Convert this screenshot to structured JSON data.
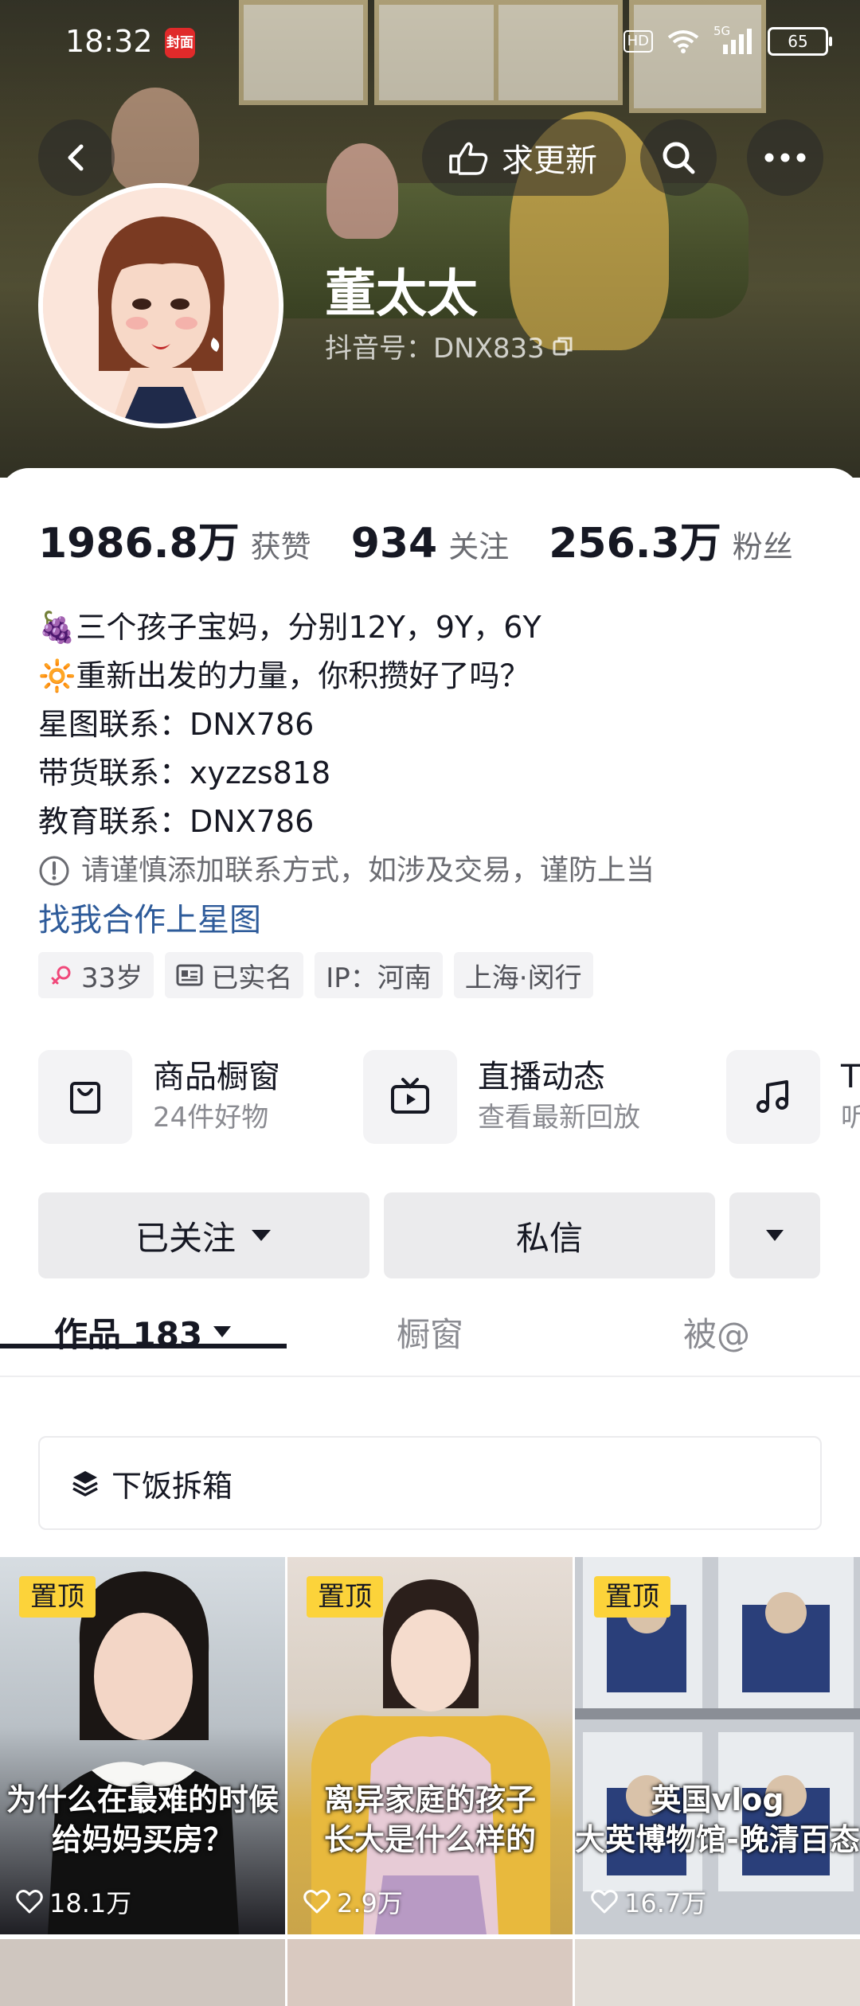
{
  "status_bar": {
    "time": "18:32",
    "news_badge": "封面",
    "hd": "HD",
    "network": "5G",
    "battery": "65"
  },
  "header": {
    "update_label": "求更新",
    "nickname": "董太太",
    "douyin_id": "抖音号：DNX833"
  },
  "stats": [
    {
      "value": "1986.8万",
      "label": "获赞"
    },
    {
      "value": "934",
      "label": "关注"
    },
    {
      "value": "256.3万",
      "label": "粉丝"
    }
  ],
  "bio": {
    "lines": [
      "🍇三个孩子宝妈，分别12Y，9Y，6Y",
      "🔆重新出发的力量，你积攒好了吗？",
      "星图联系：DNX786",
      "带货联系：xyzzs818",
      "教育联系：DNX786"
    ],
    "warning": "请谨慎添加联系方式，如涉及交易，谨防上当",
    "link": "找我合作上星图"
  },
  "tags": [
    {
      "icon": "female-icon",
      "text": "33岁"
    },
    {
      "icon": "id-card-icon",
      "text": "已实名"
    },
    {
      "icon": "",
      "text": "IP：河南"
    },
    {
      "icon": "",
      "text": "上海·闵行"
    }
  ],
  "services": [
    {
      "icon": "shopping-bag-icon",
      "title": "商品橱窗",
      "sub": "24件好物"
    },
    {
      "icon": "tv-icon",
      "title": "直播动态",
      "sub": "查看最新回放"
    },
    {
      "icon": "music-note-icon",
      "title": "T",
      "sub": "听"
    }
  ],
  "actions": {
    "follow": "已关注",
    "message": "私信"
  },
  "tabs": [
    {
      "label": "作品 183",
      "active": true
    },
    {
      "label": "橱窗",
      "active": false
    },
    {
      "label": "被@",
      "active": false
    }
  ],
  "collection": {
    "label": "下饭拆箱"
  },
  "videos": [
    {
      "pin": "置顶",
      "caption": "为什么在最难的时候\n给妈妈买房？",
      "likes": "18.1万"
    },
    {
      "pin": "置顶",
      "caption": "离异家庭的孩子\n长大是什么样的",
      "likes": "2.9万"
    },
    {
      "pin": "置顶",
      "caption": "英国vlog\n大英博物馆-晚清百态",
      "likes": "16.7万"
    }
  ],
  "colors": {
    "link": "#2e5b9a",
    "pin_badge": "#fcd33a",
    "text_primary": "#161823",
    "text_secondary": "#6b6c72"
  }
}
